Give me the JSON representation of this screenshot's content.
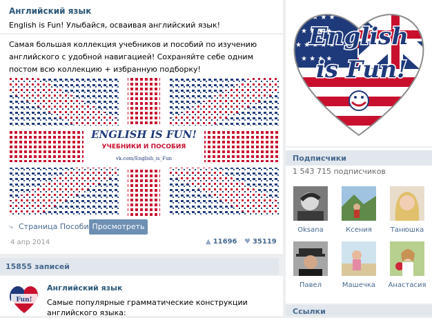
{
  "group": {
    "name": "Английский язык",
    "status": "English is Fun! Улыбайся, осваивая английский язык!"
  },
  "post": {
    "text": "Самая большая коллекция учебников и пособий по изучению английского с удобной навигацией! Сохраняйте себе одним постом всю коллекцию + избранную подборку!",
    "banner": {
      "title": "ENGLISH IS FUN!",
      "subtitle": "УЧЕБНИКИ И ПОСОБИЯ",
      "url": "vk.com/English_is_Fun"
    },
    "link_icon": "page-link-icon",
    "link_label": "Страница Пособия",
    "view_button": "Просмотреть",
    "date": "4 апр 2014",
    "shares": "11696",
    "likes": "35119"
  },
  "records": {
    "label": "15855 записей"
  },
  "post2": {
    "author": "Английский язык",
    "text": "Самые популярные грамматические конструкции английского языка:"
  },
  "logo": {
    "line1": "English",
    "line2": "is Fun!"
  },
  "subscribers": {
    "title": "Подписчики",
    "count": "1 543 715 подписчиков",
    "people": [
      {
        "name": "Oksana"
      },
      {
        "name": "Ксения"
      },
      {
        "name": "Танюшка"
      },
      {
        "name": "Павел"
      },
      {
        "name": "Машечка"
      },
      {
        "name": "Анастасия"
      }
    ]
  },
  "links": {
    "title": "Ссылки"
  },
  "colors": {
    "link_blue": "#2b587a",
    "button_blue": "#6d8fb3",
    "flag_red": "#c8102e",
    "flag_navy": "#1f3a7a"
  }
}
